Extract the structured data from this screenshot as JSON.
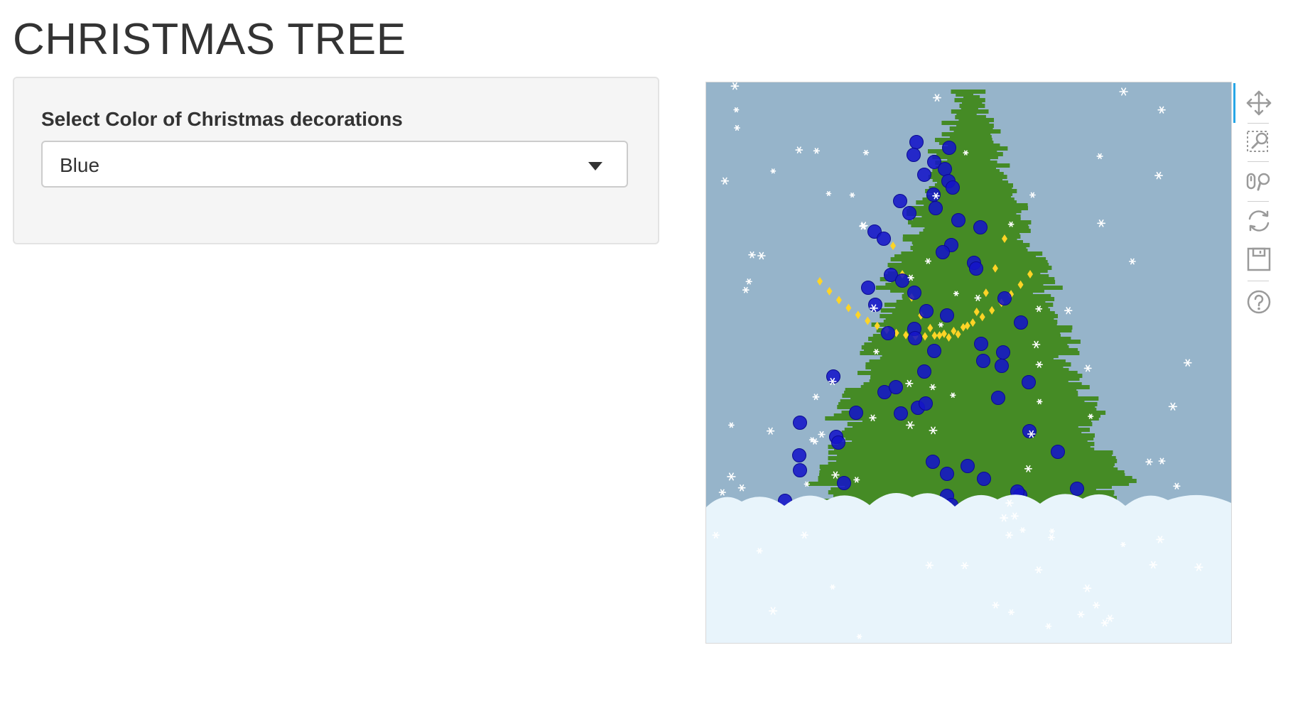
{
  "page": {
    "title": "CHRISTMAS TREE"
  },
  "controls": {
    "label": "Select Color of Christmas decorations",
    "selected": "Blue"
  },
  "scene": {
    "sky_color": "#96b4ca",
    "tree_color": "#458b25",
    "trunk_color": "#9a5b32",
    "snow_color": "#e8f4fb",
    "ornament_color": "#1414c8",
    "garland_color": "#ffd426"
  },
  "toolbar": {
    "tools": [
      "pan-icon",
      "box-zoom-icon",
      "wheel-zoom-icon",
      "reset-icon",
      "save-icon",
      "help-icon"
    ]
  }
}
